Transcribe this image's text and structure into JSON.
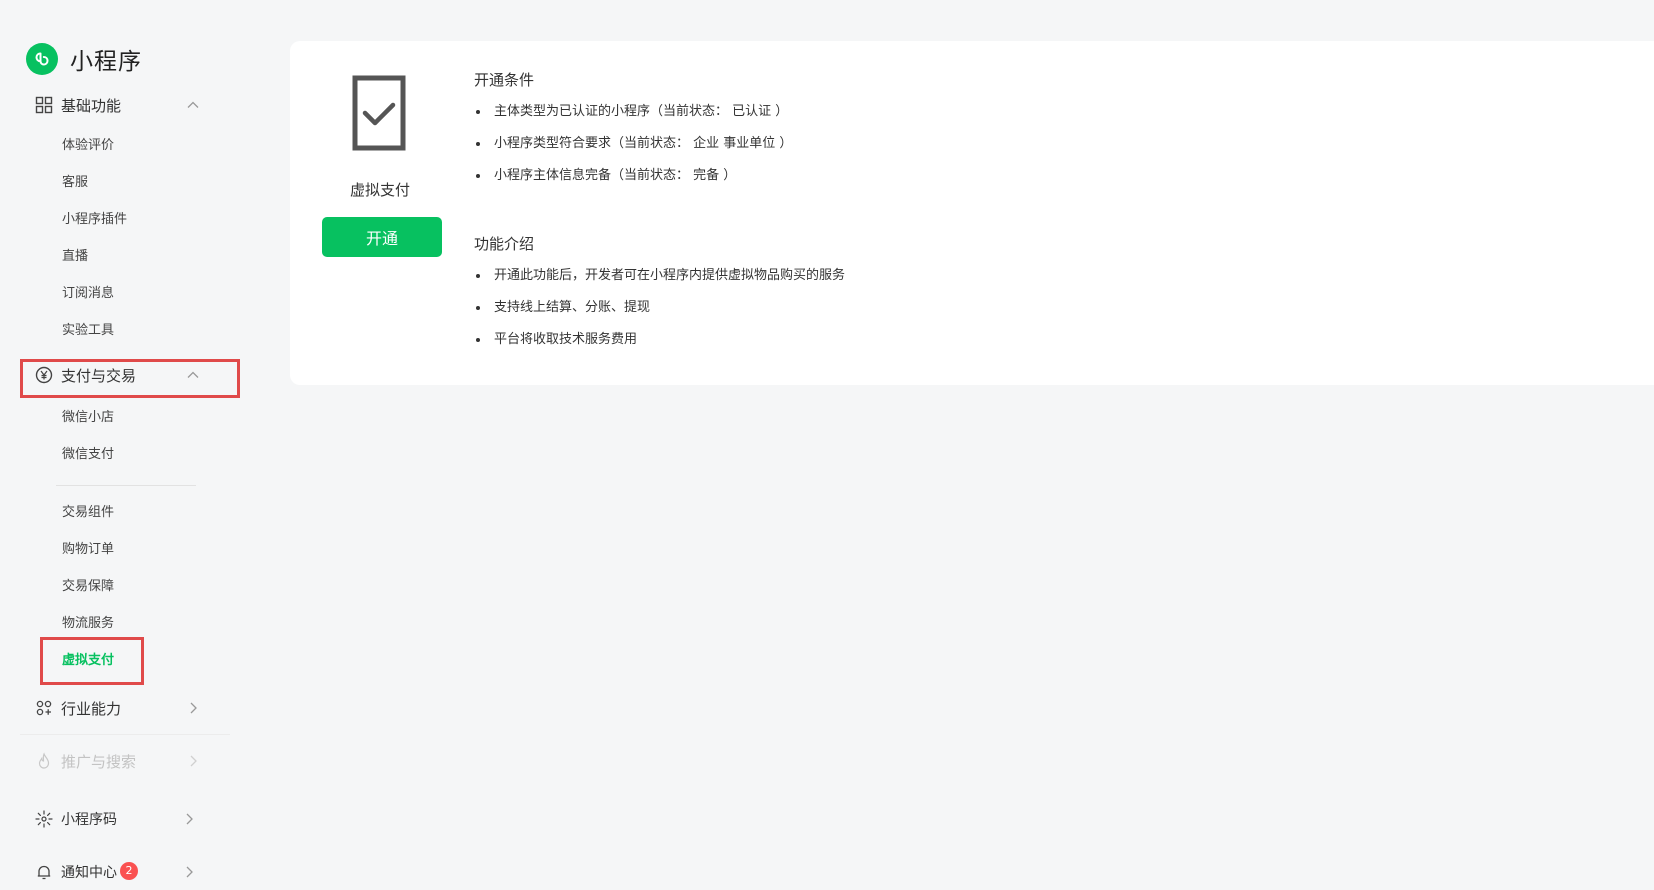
{
  "app": {
    "title": "小程序"
  },
  "sidebar": {
    "sections": [
      {
        "label": "基础功能",
        "icon": "grid-icon",
        "expanded": true,
        "items": [
          "体验评价",
          "客服",
          "小程序插件",
          "直播",
          "订阅消息",
          "实验工具"
        ]
      },
      {
        "label": "支付与交易",
        "icon": "yen-circle-icon",
        "expanded": true,
        "items_group_1": [
          "微信小店",
          "微信支付"
        ],
        "items_group_2": [
          "交易组件",
          "购物订单",
          "交易保障",
          "物流服务",
          "虚拟支付"
        ],
        "active_item": "虚拟支付"
      },
      {
        "label": "行业能力",
        "icon": "industry-icon",
        "expanded": false
      },
      {
        "label": "推广与搜索",
        "icon": "flame-icon",
        "expanded": false,
        "disabled": true
      },
      {
        "label": "小程序码",
        "icon": "qrcode-sun-icon",
        "expanded": false
      },
      {
        "label": "通知中心",
        "icon": "bell-icon",
        "expanded": false,
        "badge": "2"
      }
    ]
  },
  "main": {
    "function_name": "虚拟支付",
    "open_button": "开通",
    "conditions": {
      "title": "开通条件",
      "items": [
        "主体类型为已认证的小程序（当前状态： 已认证 ）",
        "小程序类型符合要求（当前状态： 企业 事业单位 ）",
        "小程序主体信息完备（当前状态： 完备 ）"
      ]
    },
    "intro": {
      "title": "功能介绍",
      "items": [
        "开通此功能后，开发者可在小程序内提供虚拟物品购买的服务",
        "支持线上结算、分账、提现",
        "平台将收取技术服务费用"
      ]
    }
  },
  "colors": {
    "brand_green": "#07c160",
    "highlight_red": "#e04a4a",
    "badge_red": "#fa5151",
    "page_bg": "#f5f6f7"
  }
}
